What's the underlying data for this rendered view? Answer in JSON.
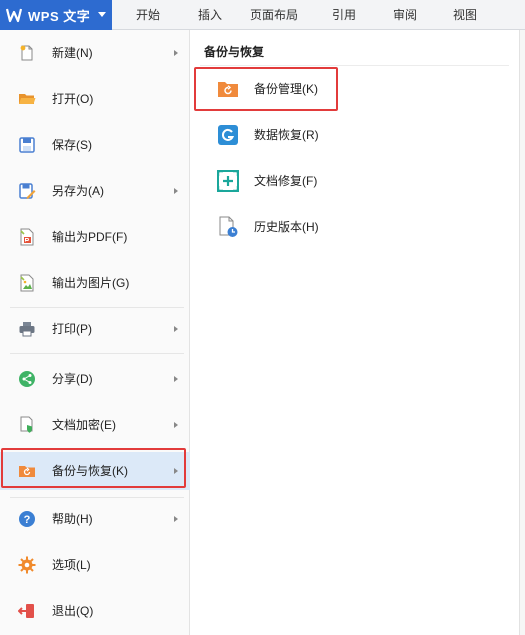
{
  "app": {
    "title": "WPS 文字"
  },
  "ribbon": {
    "tabs": [
      "开始",
      "插入",
      "页面布局",
      "引用",
      "审阅",
      "视图"
    ]
  },
  "file_menu": {
    "items": [
      {
        "label": "新建(N)",
        "icon": "new-doc-icon",
        "has_submenu": true
      },
      {
        "label": "打开(O)",
        "icon": "folder-open-icon",
        "has_submenu": false
      },
      {
        "label": "保存(S)",
        "icon": "save-icon",
        "has_submenu": false
      },
      {
        "label": "另存为(A)",
        "icon": "save-as-icon",
        "has_submenu": true
      },
      {
        "label": "输出为PDF(F)",
        "icon": "export-pdf-icon",
        "has_submenu": false
      },
      {
        "label": "输出为图片(G)",
        "icon": "export-image-icon",
        "has_submenu": false
      },
      {
        "label": "打印(P)",
        "icon": "printer-icon",
        "has_submenu": true
      },
      {
        "label": "分享(D)",
        "icon": "share-icon",
        "has_submenu": true
      },
      {
        "label": "文档加密(E)",
        "icon": "encrypt-doc-icon",
        "has_submenu": true
      },
      {
        "label": "备份与恢复(K)",
        "icon": "backup-restore-icon",
        "has_submenu": true,
        "active": true
      },
      {
        "label": "帮助(H)",
        "icon": "help-icon",
        "has_submenu": true
      },
      {
        "label": "选项(L)",
        "icon": "options-gear-icon",
        "has_submenu": false
      },
      {
        "label": "退出(Q)",
        "icon": "exit-icon",
        "has_submenu": false
      }
    ]
  },
  "submenu": {
    "title": "备份与恢复",
    "items": [
      {
        "label": "备份管理(K)",
        "icon": "backup-folder-icon",
        "highlighted": true
      },
      {
        "label": "数据恢复(R)",
        "icon": "data-recovery-icon"
      },
      {
        "label": "文档修复(F)",
        "icon": "doc-repair-icon"
      },
      {
        "label": "历史版本(H)",
        "icon": "history-version-icon"
      }
    ]
  },
  "colors": {
    "brand": "#2d6bd0",
    "highlight_border": "#e23b3b",
    "active_row": "#dce9f8",
    "backup_orange": "#f08a3c",
    "recovery_blue": "#2d8ed6",
    "repair_teal": "#1aa79b"
  }
}
